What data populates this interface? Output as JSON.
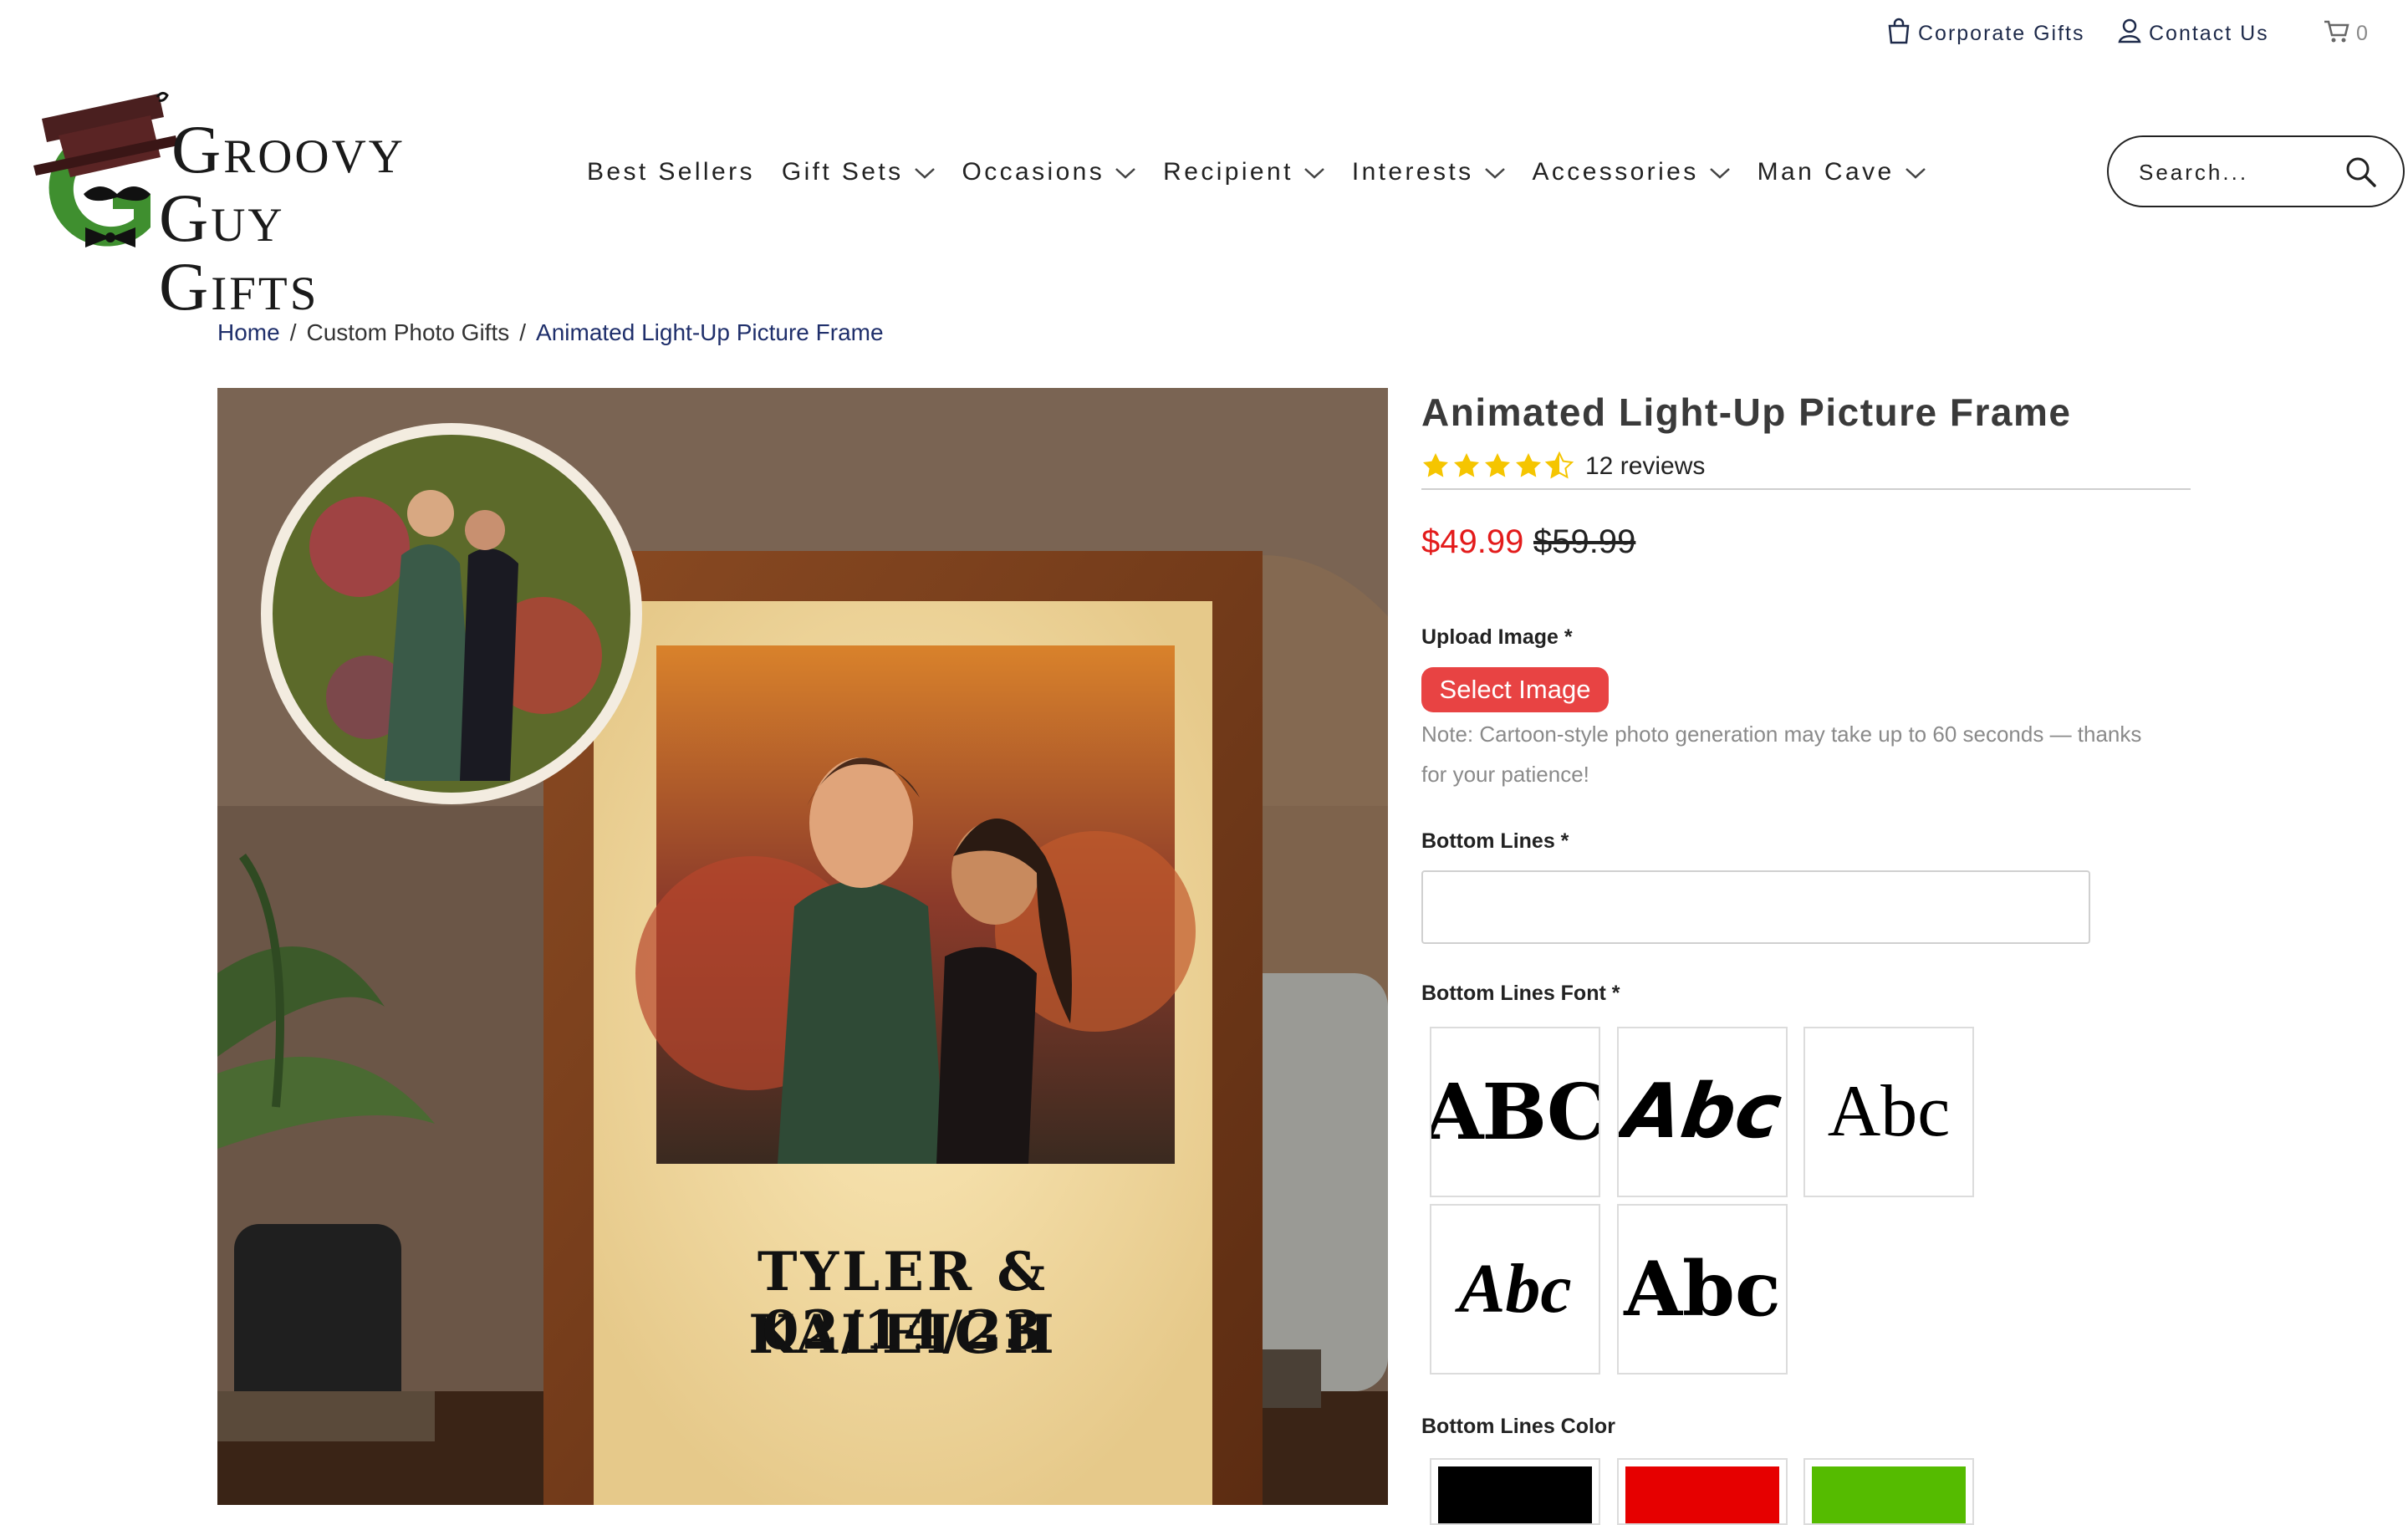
{
  "header": {
    "utility": {
      "corporate_gifts": "Corporate Gifts",
      "contact_us": "Contact Us",
      "cart_count": "0"
    },
    "logo": {
      "line1": "Groovy",
      "line2": "Guy Gifts"
    },
    "nav": [
      {
        "label": "Best Sellers",
        "dropdown": false
      },
      {
        "label": "Gift Sets",
        "dropdown": true
      },
      {
        "label": "Occasions",
        "dropdown": true
      },
      {
        "label": "Recipient",
        "dropdown": true
      },
      {
        "label": "Interests",
        "dropdown": true
      },
      {
        "label": "Accessories",
        "dropdown": true
      },
      {
        "label": "Man Cave",
        "dropdown": true
      }
    ],
    "search": {
      "placeholder": "Search..."
    }
  },
  "breadcrumb": {
    "home": "Home",
    "category": "Custom Photo Gifts",
    "current": "Animated Light-Up Picture Frame"
  },
  "hero": {
    "frame_line1": "TYLER & KALEIGH",
    "frame_line2": "02/14/23"
  },
  "product": {
    "title": "Animated Light-Up Picture Frame",
    "rating": 4.5,
    "reviews": "12 reviews",
    "price": "$49.99",
    "compare_price": "$59.99",
    "accent_color": "#e84343",
    "price_color": "#e31b1b"
  },
  "form": {
    "upload_label": "Upload Image *",
    "select_button": "Select Image",
    "note": "Note: Cartoon-style photo generation may take up to 60 seconds — thanks for your patience!",
    "bottom_lines_label": "Bottom Lines *",
    "bottom_lines_value": "",
    "font_label": "Bottom Lines Font *",
    "font_samples": [
      "ABC",
      "Abc",
      "Abc",
      "Abc",
      "Abc"
    ],
    "color_label": "Bottom Lines Color",
    "colors": [
      "#000000",
      "#e60000",
      "#55bb00"
    ]
  }
}
